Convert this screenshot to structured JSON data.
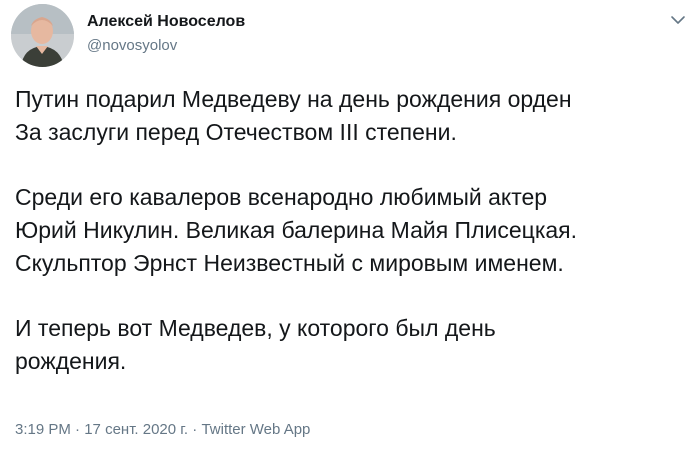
{
  "author": {
    "name": "Алексей Новоселов",
    "handle": "@novosyolov",
    "avatar_icon": "user-avatar-photo"
  },
  "menu_icon": "chevron-down-icon",
  "tweet": {
    "paragraphs": [
      [
        "Путин подарил Медведеву на день рождения орден",
        "За заслуги перед Отечеством III степени."
      ],
      [
        "Среди его кавалеров всенародно любимый актер",
        "Юрий Никулин. Великая балерина Майя Плисецкая.",
        "Скульптор Эрнст Неизвестный с мировым именем."
      ],
      [
        "И теперь вот Медведев, у которого был день",
        "рождения."
      ]
    ]
  },
  "meta": {
    "time": "3:19 PM",
    "separator": "·",
    "date": "17 сент. 2020 г.",
    "app": "Twitter Web App"
  },
  "colors": {
    "text": "#14171a",
    "secondary": "#657786",
    "background": "#ffffff"
  }
}
